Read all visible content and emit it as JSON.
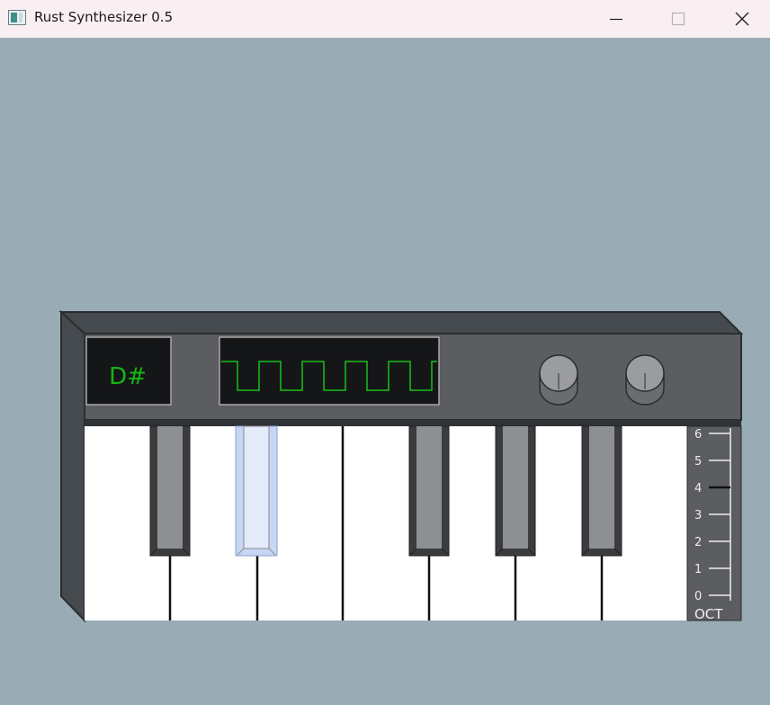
{
  "window": {
    "title": "Rust Synthesizer 0.5"
  },
  "synth": {
    "note_display": "D#",
    "note_color": "#17b317",
    "waveform": "square",
    "waveform_color": "#18c018",
    "knob_count": 2,
    "pressed_key": "D#",
    "pressed_key_color": "#e4ebfa",
    "octave": {
      "label": "OCT",
      "scale": [
        "0",
        "1",
        "2",
        "3",
        "4",
        "5",
        "6"
      ]
    },
    "white_keys": [
      "C",
      "D",
      "E",
      "F",
      "G",
      "A",
      "B"
    ],
    "black_keys": [
      "C#",
      "D#",
      "F#",
      "G#",
      "A#"
    ]
  },
  "icons": {
    "app": "app-window-icon",
    "minimize": "minimize-icon",
    "maximize": "maximize-icon",
    "close": "close-icon"
  }
}
